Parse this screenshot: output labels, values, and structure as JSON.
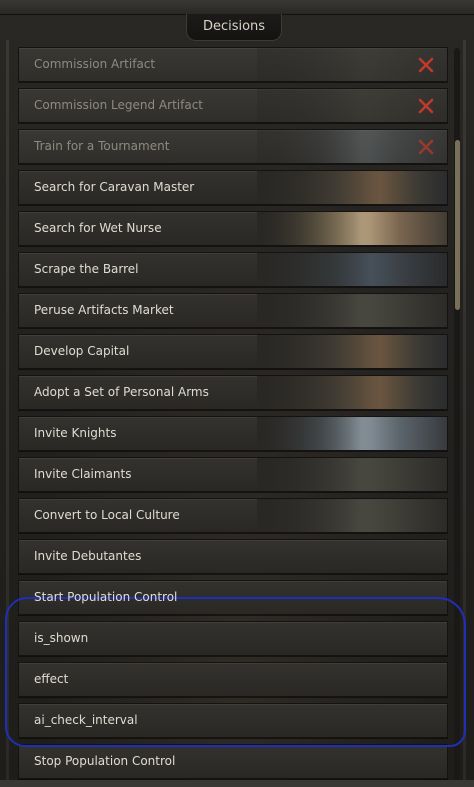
{
  "panel": {
    "title": "Decisions"
  },
  "decisions": [
    {
      "label": "Commission Artifact",
      "disabled": true
    },
    {
      "label": "Commission Legend Artifact",
      "disabled": true
    },
    {
      "label": "Train for a Tournament",
      "disabled": true
    },
    {
      "label": "Search for Caravan Master"
    },
    {
      "label": "Search for Wet Nurse"
    },
    {
      "label": "Scrape the Barrel"
    },
    {
      "label": "Peruse Artifacts Market"
    },
    {
      "label": "Develop Capital"
    },
    {
      "label": "Adopt a Set of Personal Arms"
    },
    {
      "label": "Invite Knights"
    },
    {
      "label": "Invite Claimants"
    },
    {
      "label": "Convert to Local Culture"
    },
    {
      "label": "Invite Debutantes"
    },
    {
      "label": "Start Population Control"
    },
    {
      "label": "is_shown"
    },
    {
      "label": "effect"
    },
    {
      "label": "ai_check_interval"
    },
    {
      "label": "Stop Population Control"
    }
  ],
  "icons": {
    "unavailable": "close-x-icon"
  },
  "colors": {
    "highlight": "#1f2fb8",
    "unavailable_x": "#c0392b"
  }
}
